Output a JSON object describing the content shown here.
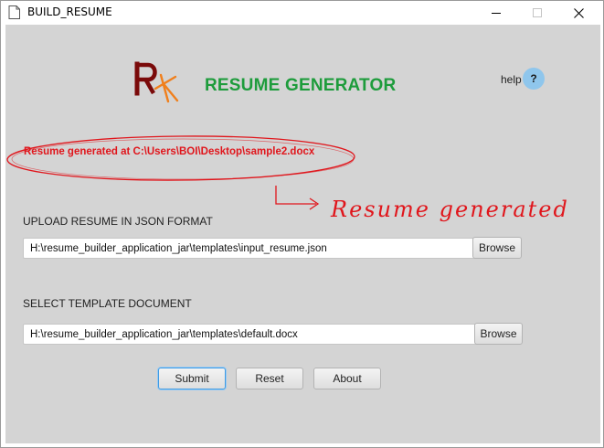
{
  "window": {
    "title": "BUILD_RESUME",
    "controls": {
      "minimize_icon": "minimize-icon",
      "maximize_icon": "maximize-icon",
      "close_icon": "close-icon"
    }
  },
  "header": {
    "logo_icon": "rk-logo-icon",
    "title": "RESUME GENERATOR",
    "title_color": "#1e9c3c",
    "help_label": "help",
    "help_button": "?",
    "help_button_color": "#8fc6ec"
  },
  "status": {
    "message": "Resume generated at C:\\Users\\BOI\\Desktop\\sample2.docx",
    "color": "#e0161c"
  },
  "annotation": {
    "text": "Resume generated"
  },
  "json_upload": {
    "label": "UPLOAD RESUME IN JSON FORMAT",
    "value": "H:\\resume_builder_application_jar\\templates\\input_resume.json",
    "browse_label": "Browse"
  },
  "template_select": {
    "label": "SELECT TEMPLATE DOCUMENT",
    "value": "H:\\resume_builder_application_jar\\templates\\default.docx",
    "browse_label": "Browse"
  },
  "actions": {
    "submit_label": "Submit",
    "reset_label": "Reset",
    "about_label": "About"
  }
}
